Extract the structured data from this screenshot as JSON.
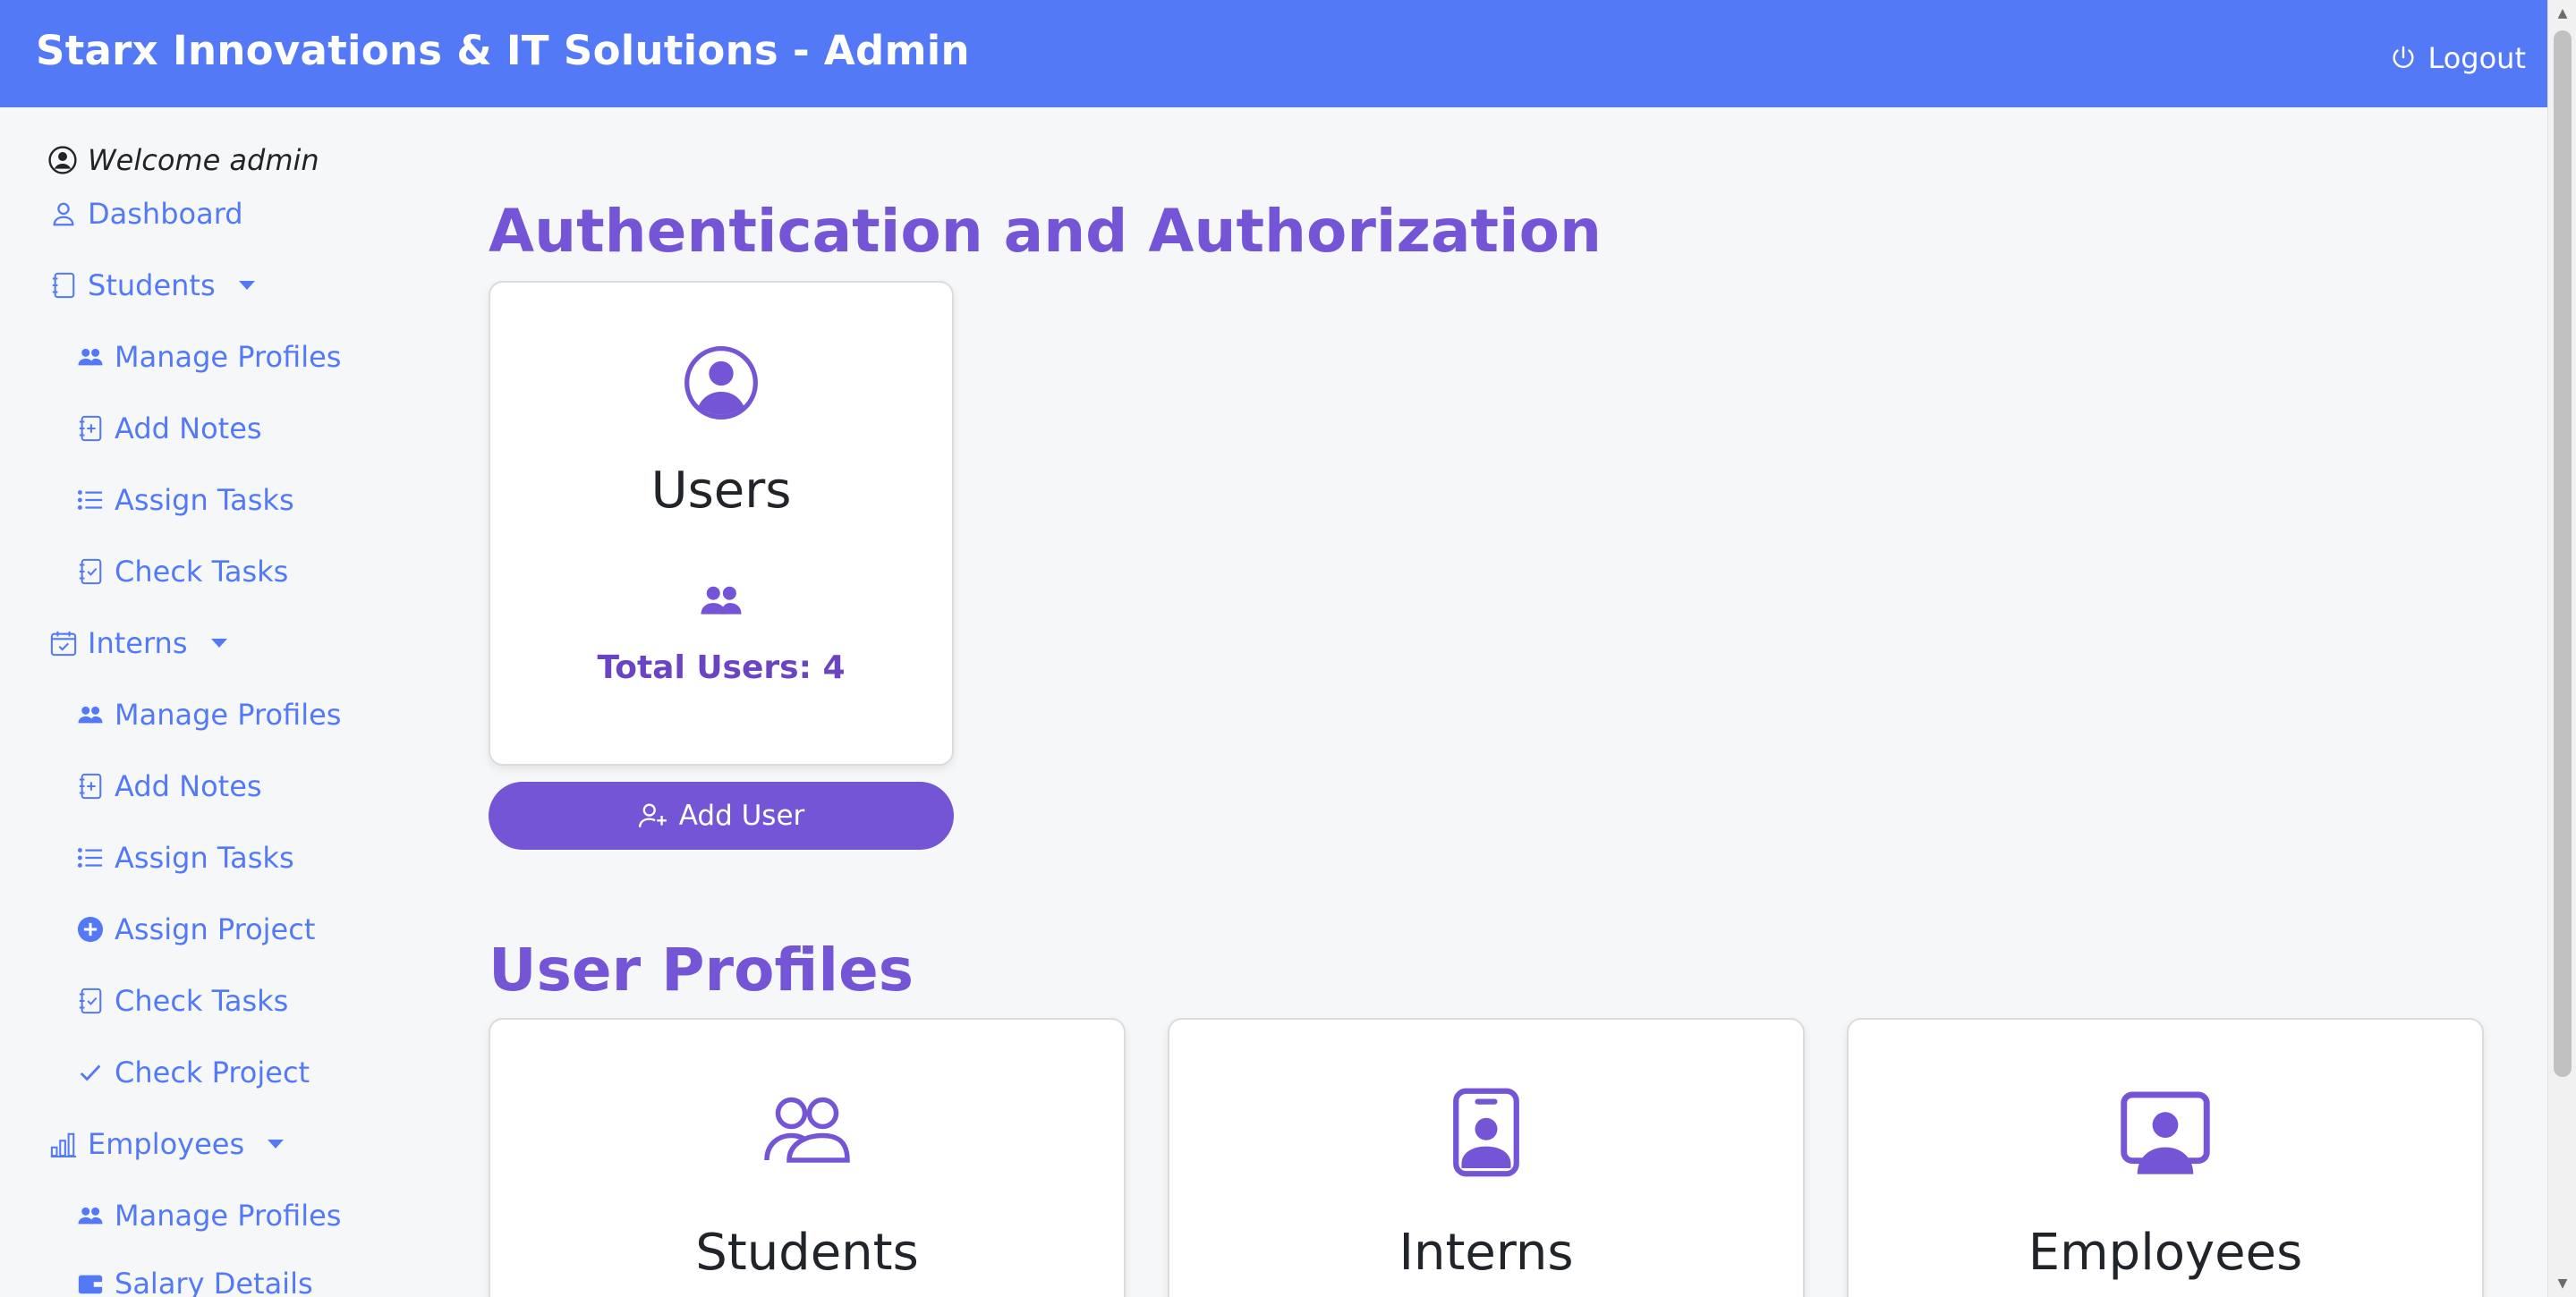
{
  "header": {
    "title": "Starx Innovations & IT Solutions - Admin",
    "logout_label": "Logout"
  },
  "sidebar": {
    "welcome": "Welcome admin",
    "items": [
      {
        "label": "Dashboard",
        "icon": "user-icon"
      },
      {
        "label": "Students",
        "icon": "journal-icon",
        "dropdown": true
      },
      {
        "label": "Manage Profiles",
        "icon": "people-icon"
      },
      {
        "label": "Add Notes",
        "icon": "journal-plus-icon"
      },
      {
        "label": "Assign Tasks",
        "icon": "list-icon"
      },
      {
        "label": "Check Tasks",
        "icon": "journal-check-icon"
      },
      {
        "label": "Interns",
        "icon": "calendar-check-icon",
        "dropdown": true
      },
      {
        "label": "Manage Profiles",
        "icon": "people-icon"
      },
      {
        "label": "Add Notes",
        "icon": "journal-plus-icon"
      },
      {
        "label": "Assign Tasks",
        "icon": "list-icon"
      },
      {
        "label": "Assign Project",
        "icon": "plus-circle-icon"
      },
      {
        "label": "Check Tasks",
        "icon": "journal-check-icon"
      },
      {
        "label": "Check Project",
        "icon": "check-icon"
      },
      {
        "label": "Employees",
        "icon": "bar-chart-icon",
        "dropdown": true
      },
      {
        "label": "Manage Profiles",
        "icon": "people-icon"
      },
      {
        "label": "Salary Details",
        "icon": "wallet-icon"
      }
    ]
  },
  "main": {
    "auth_title": "Authentication and Authorization",
    "users_card": {
      "title": "Users",
      "count_label": "Total Users: 4"
    },
    "add_user_label": "Add User",
    "profiles_title": "User Profiles",
    "profile_cards": [
      {
        "title": "Students",
        "icon": "people-outline-icon"
      },
      {
        "title": "Interns",
        "icon": "badge-icon"
      },
      {
        "title": "Employees",
        "icon": "person-video-icon"
      }
    ]
  },
  "colors": {
    "header": "#5479f7",
    "accent": "#7355d6",
    "link": "#5479f7"
  }
}
